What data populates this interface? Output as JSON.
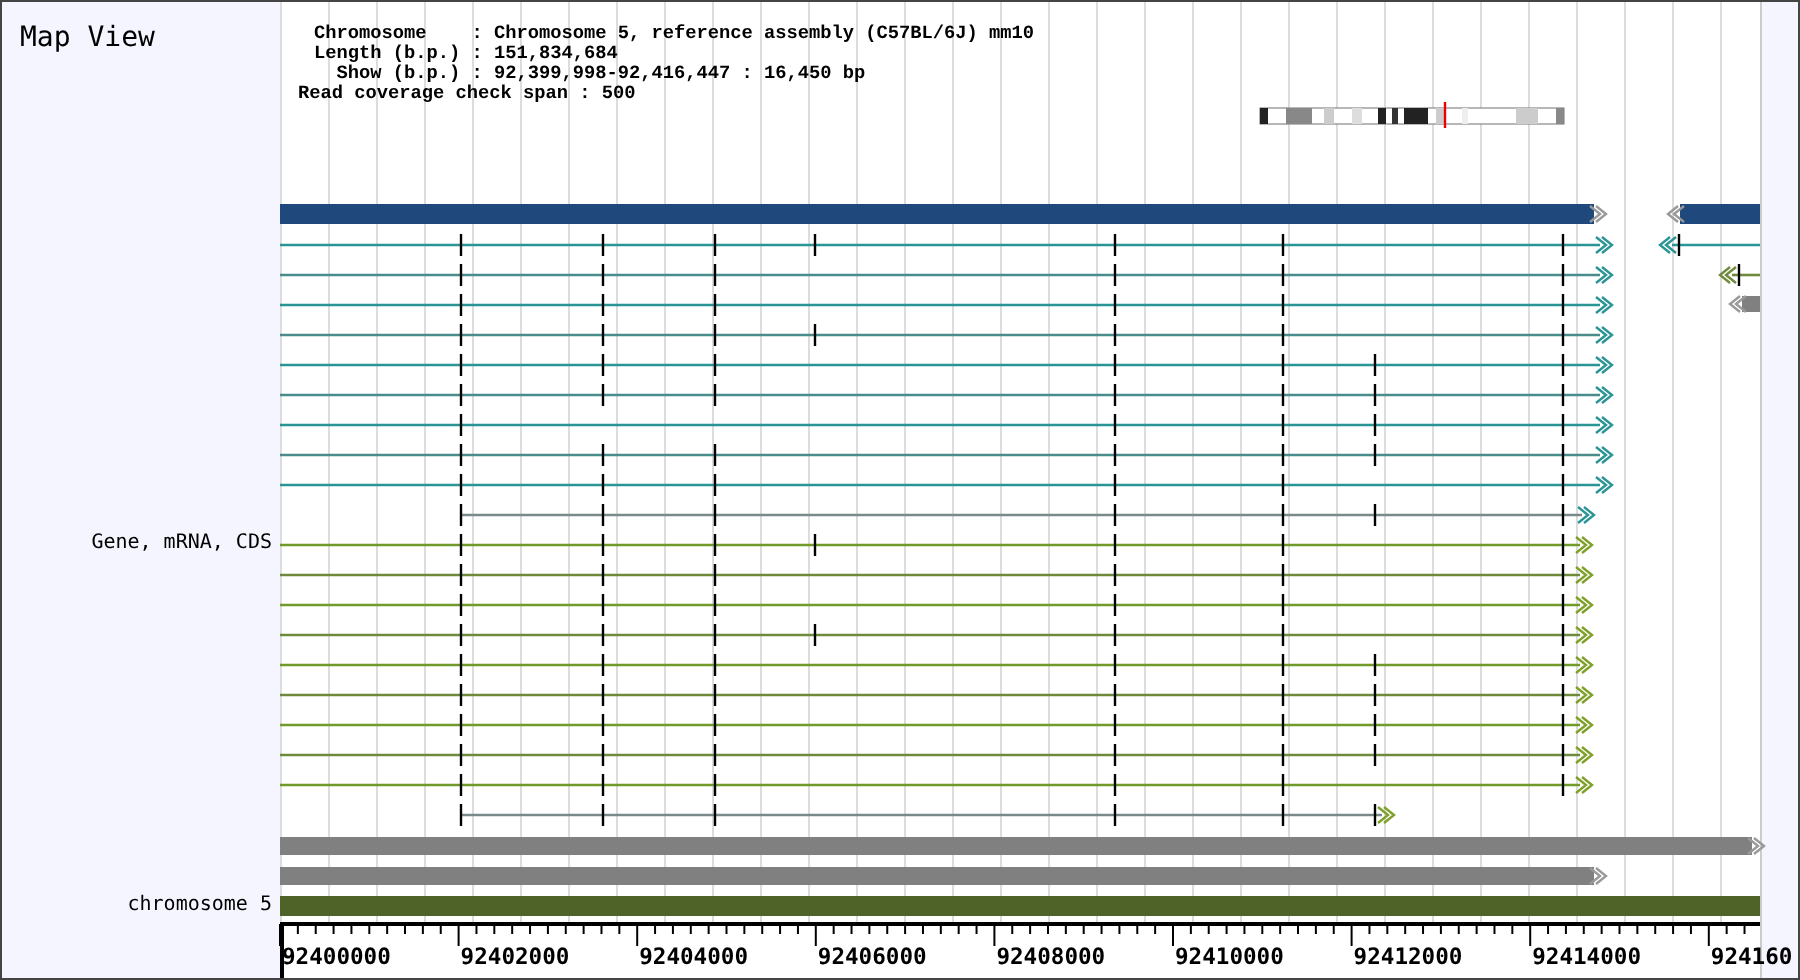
{
  "title": "Map View",
  "info_lines": [
    "Chromosome    : Chromosome 5, reference assembly (C57BL/6J) mm10",
    "Length (b.p.) : 151,834,684",
    "  Show (b.p.) : 92,399,998-92,416,447 : 16,450 bp",
    "Read coverage check span : 500"
  ],
  "tracks": [
    {
      "label": "Gene, mRNA, CDS"
    },
    {
      "label": "chromosome 5"
    }
  ],
  "axis_labels": [
    "92400000",
    "92402000",
    "92404000",
    "92406000",
    "92408000",
    "92410000",
    "92412000",
    "92414000",
    "924160"
  ]
}
